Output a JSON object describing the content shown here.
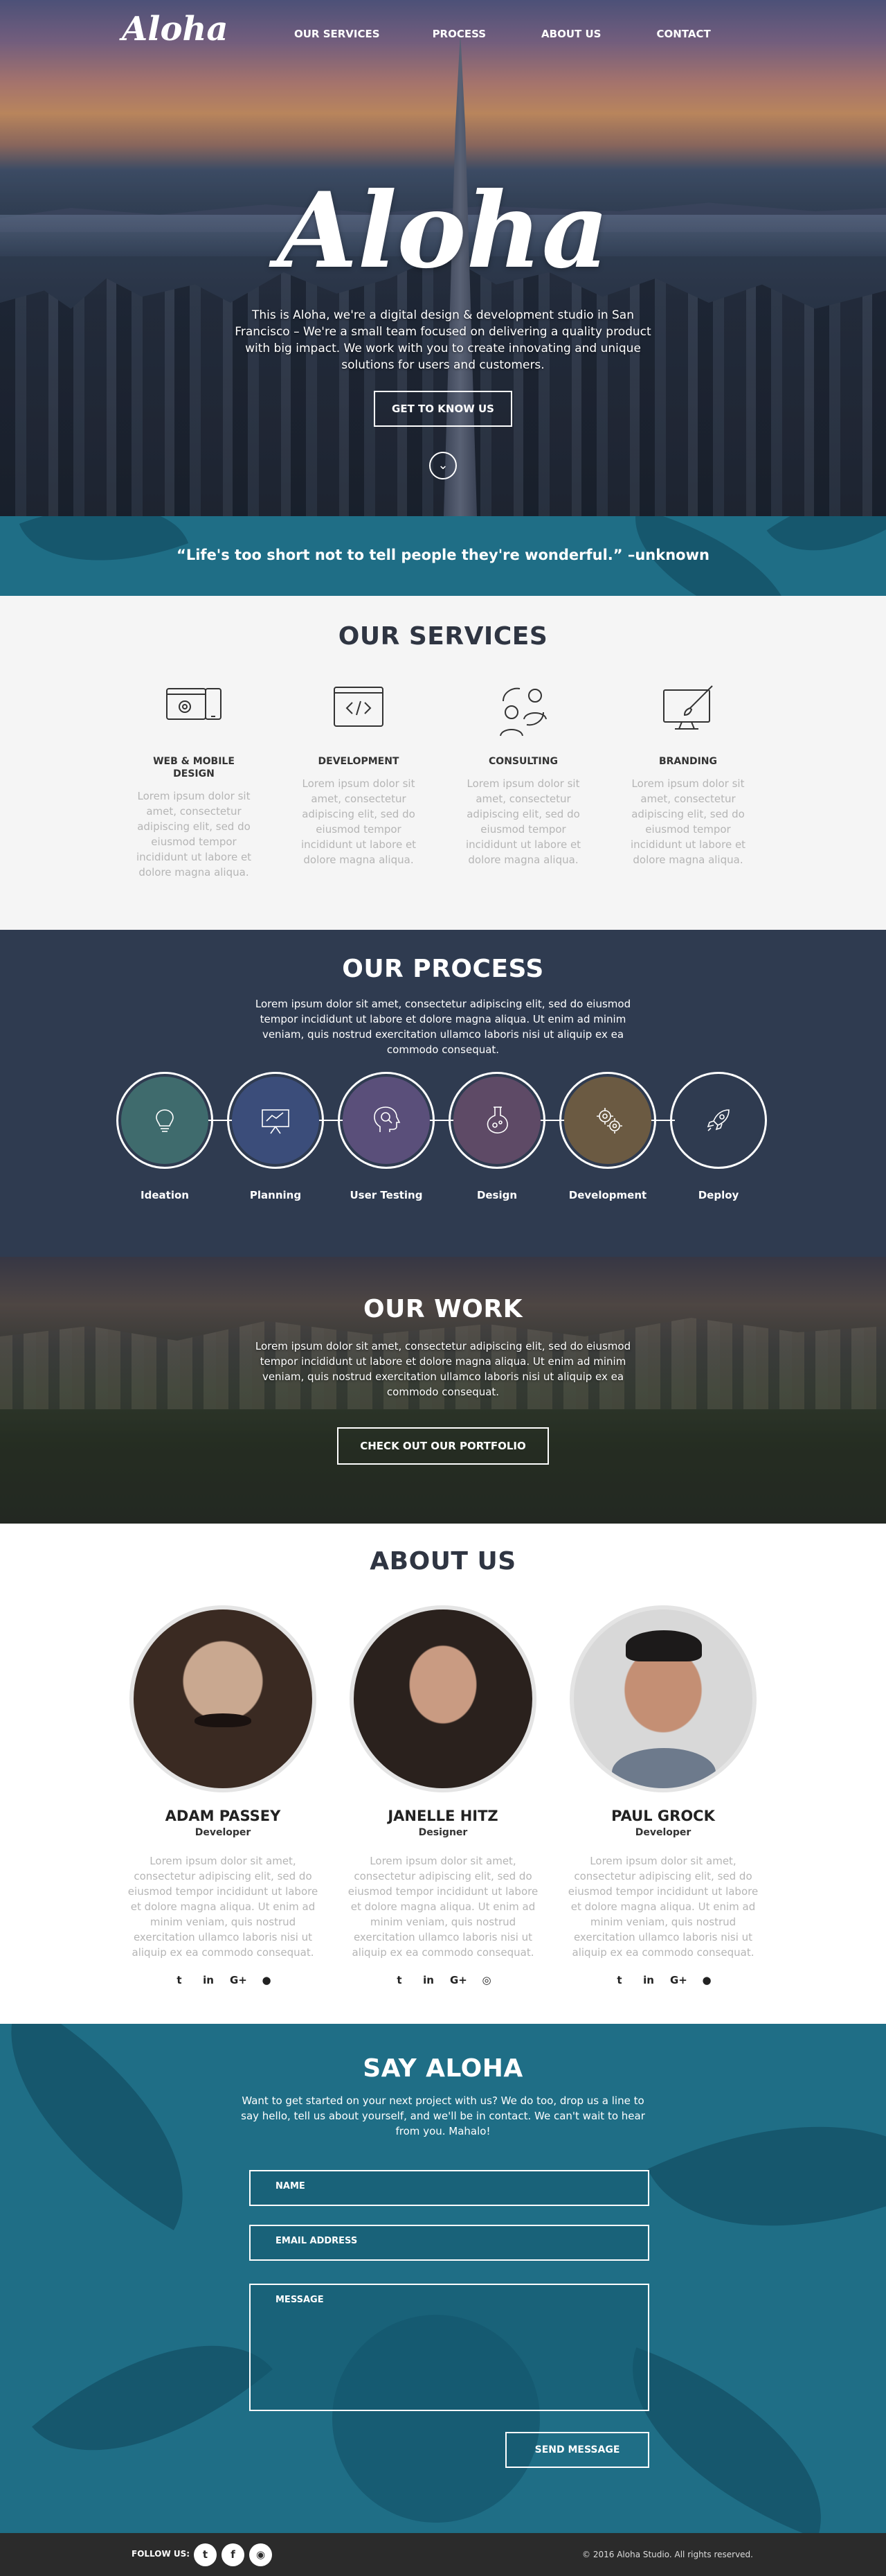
{
  "nav": {
    "logo": "Aloha",
    "items": [
      "OUR SERVICES",
      "PROCESS",
      "ABOUT US",
      "CONTACT"
    ]
  },
  "hero": {
    "title": "Aloha",
    "text": "This is Aloha, we're a digital design & development studio in San Francisco – We're a small team focused on delivering a quality product with big impact. We work with you to create innovating and unique solutions for users and customers.",
    "button": "GET TO KNOW US",
    "scroll_icon": "chevron-down-icon"
  },
  "quote": {
    "text": "“Life's too short not to tell people they're wonderful.” –unknown"
  },
  "services": {
    "title": "OUR SERVICES",
    "items": [
      {
        "title": "WEB & MOBILE DESIGN",
        "icon": "devices-gear-icon",
        "text": "Lorem ipsum dolor sit amet, consectetur adipiscing elit, sed do eiusmod tempor incididunt ut labore et dolore magna aliqua."
      },
      {
        "title": "DEVELOPMENT",
        "icon": "code-window-icon",
        "text": "Lorem ipsum dolor sit amet, consectetur adipiscing elit, sed do eiusmod tempor incididunt ut labore et dolore magna aliqua."
      },
      {
        "title": "CONSULTING",
        "icon": "people-chat-icon",
        "text": "Lorem ipsum dolor sit amet, consectetur adipiscing elit, sed do eiusmod tempor incididunt ut labore et dolore magna aliqua."
      },
      {
        "title": "BRANDING",
        "icon": "monitor-brush-icon",
        "text": "Lorem ipsum dolor sit amet, consectetur adipiscing elit, sed do eiusmod tempor incididunt ut labore et dolore magna aliqua."
      }
    ]
  },
  "process": {
    "title": "OUR PROCESS",
    "text": "Lorem ipsum dolor sit amet, consectetur adipiscing elit, sed do eiusmod tempor incididunt ut labore et dolore magna aliqua. Ut enim ad minim veniam, quis nostrud exercitation ullamco laboris nisi ut aliquip ex ea commodo consequat.",
    "steps": [
      {
        "label": "Ideation",
        "icon": "lightbulb-icon",
        "color": "#3f6b6d"
      },
      {
        "label": "Planning",
        "icon": "presentation-board-icon",
        "color": "#3b4d7a"
      },
      {
        "label": "User Testing",
        "icon": "head-search-icon",
        "color": "#5a4f7a"
      },
      {
        "label": "Design",
        "icon": "flask-icon",
        "color": "#5e4a66"
      },
      {
        "label": "Development",
        "icon": "gears-icon",
        "color": "#6b5a42"
      },
      {
        "label": "Deploy",
        "icon": "rocket-icon",
        "color": "#2f3b50"
      }
    ]
  },
  "work": {
    "title": "OUR WORK",
    "text": "Lorem ipsum dolor sit amet, consectetur adipiscing elit, sed do eiusmod tempor incididunt ut labore et dolore magna aliqua. Ut enim ad minim veniam, quis nostrud exercitation ullamco laboris nisi ut aliquip ex ea commodo consequat.",
    "button": "CHECK OUT OUR PORTFOLIO"
  },
  "about": {
    "title": "ABOUT US",
    "members": [
      {
        "name": "ADAM PASSEY",
        "role": "Developer",
        "text": "Lorem ipsum dolor sit amet, consectetur adipiscing elit, sed do eiusmod tempor incididunt ut labore et dolore magna aliqua. Ut enim ad minim veniam, quis nostrud exercitation ullamco laboris nisi ut aliquip ex ea commodo consequat.",
        "socials": [
          "twitter-icon",
          "linkedin-icon",
          "google-plus-icon",
          "github-icon"
        ],
        "photo_colors": [
          "#3a2a22",
          "#c9a890"
        ]
      },
      {
        "name": "JANELLE HITZ",
        "role": "Designer",
        "text": "Lorem ipsum dolor sit amet, consectetur adipiscing elit, sed do eiusmod tempor incididunt ut labore et dolore magna aliqua. Ut enim ad minim veniam, quis nostrud exercitation ullamco laboris nisi ut aliquip ex ea commodo consequat.",
        "socials": [
          "twitter-icon",
          "linkedin-icon",
          "google-plus-icon",
          "dribbble-icon"
        ],
        "photo_colors": [
          "#2a211d",
          "#c99b82"
        ]
      },
      {
        "name": "PAUL GROCK",
        "role": "Developer",
        "text": "Lorem ipsum dolor sit amet, consectetur adipiscing elit, sed do eiusmod tempor incididunt ut labore et dolore magna aliqua. Ut enim ad minim veniam, quis nostrud exercitation ullamco laboris nisi ut aliquip ex ea commodo consequat.",
        "socials": [
          "twitter-icon",
          "linkedin-icon",
          "google-plus-icon",
          "github-icon"
        ],
        "photo_colors": [
          "#d8d8d8",
          "#c48f74"
        ]
      }
    ]
  },
  "contact": {
    "title": "SAY ALOHA",
    "text": "Want to get started on your next project with us? We do too, drop us a line to say hello, tell us about yourself, and we'll be in contact. We can't wait to hear from you. Mahalo!",
    "name_placeholder": "NAME",
    "email_placeholder": "EMAIL ADDRESS",
    "message_placeholder": "MESSAGE",
    "button": "SEND MESSAGE"
  },
  "footer": {
    "follow": "FOLLOW US:",
    "icons": [
      "twitter-icon",
      "facebook-icon",
      "instagram-icon"
    ],
    "copyright": "© 2016 Aloha Studio. All rights reserved."
  },
  "colors": {
    "teal": "#1f6e86",
    "navy": "#2f3b50",
    "heading": "#2f3542",
    "footer": "#2b2b2b"
  }
}
